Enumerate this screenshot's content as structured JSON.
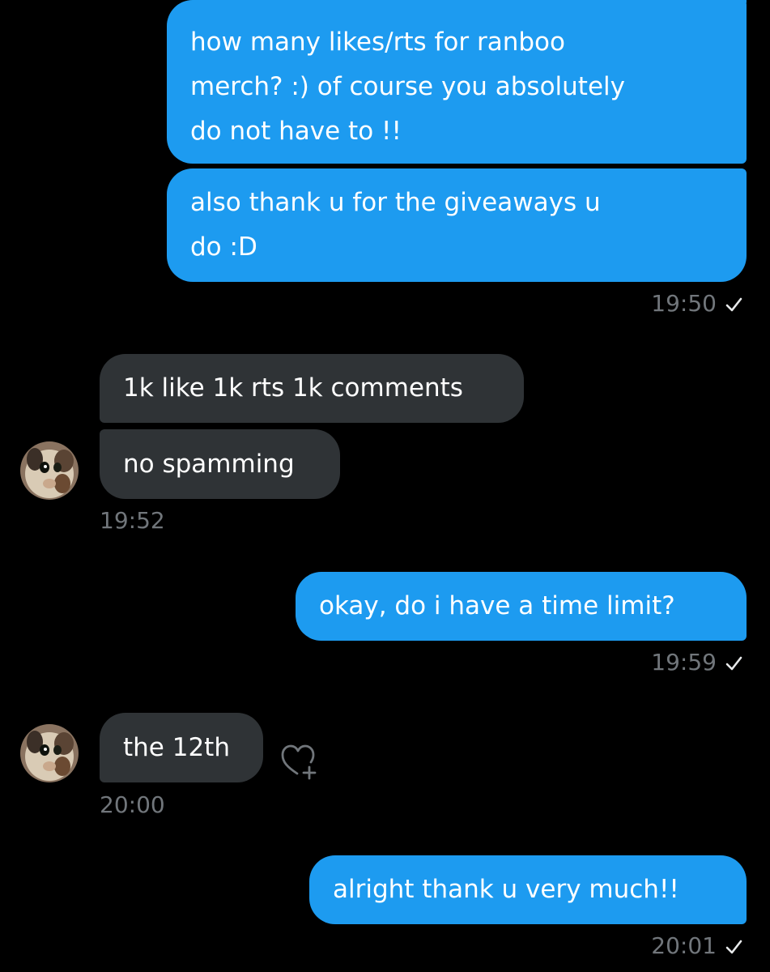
{
  "conversation": {
    "messages": [
      {
        "id": "m1",
        "direction": "outgoing",
        "text": "how many likes/rts for ranboo\nmerch? :) of course you absolutely\ndo not have to !!"
      },
      {
        "id": "m2",
        "direction": "outgoing",
        "text": "also thank u for the giveaways u\ndo :D"
      },
      {
        "id": "m3",
        "direction": "incoming",
        "text": "1k like 1k rts 1k comments"
      },
      {
        "id": "m4",
        "direction": "incoming",
        "text": "no spamming"
      },
      {
        "id": "m5",
        "direction": "outgoing",
        "text": "okay, do i have a time limit?"
      },
      {
        "id": "m6",
        "direction": "incoming",
        "text": "the 12th"
      },
      {
        "id": "m7",
        "direction": "outgoing",
        "text": "alright thank u very much!!"
      }
    ],
    "timestamps": {
      "t1950": "19:50",
      "t1952": "19:52",
      "t1959": "19:59",
      "t2000": "20:00",
      "t2001": "20:01"
    }
  },
  "icons": {
    "read_receipt": "checkmark-icon",
    "react": "heart-plus-icon",
    "avatar": "cat-avatar"
  },
  "colors": {
    "background": "#000000",
    "outgoing_bubble": "#1d9bf0",
    "incoming_bubble": "#2f3336",
    "timestamp": "#71767b"
  }
}
